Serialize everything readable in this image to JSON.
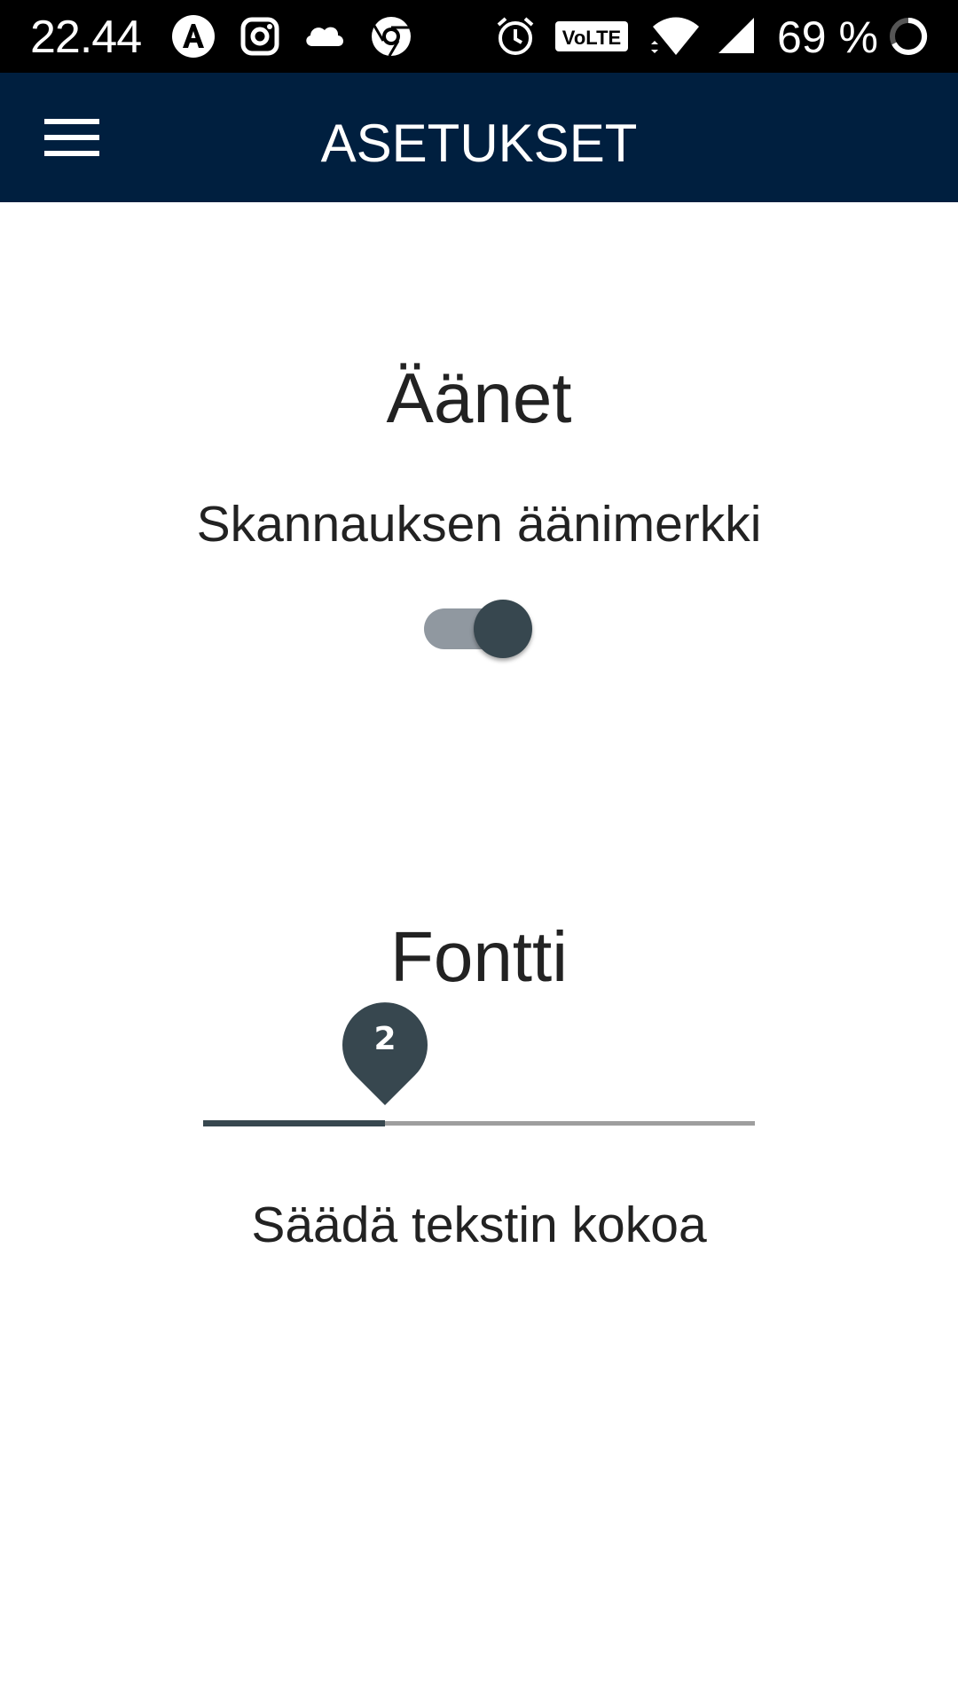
{
  "status_bar": {
    "time": "22.44",
    "battery_percent": "69 %",
    "icons": [
      "a-app-icon",
      "instagram-icon",
      "cloud-icon",
      "chrome-icon",
      "alarm-icon",
      "volte-icon",
      "wifi-icon",
      "signal-icon",
      "battery-ring-icon"
    ],
    "volte_label": "VoLTE"
  },
  "app_bar": {
    "title": "ASETUKSET",
    "background": "#001f3f",
    "menu_icon": "hamburger-menu-icon"
  },
  "sounds_section": {
    "title": "Äänet",
    "setting_label": "Skannauksen äänimerkki",
    "toggle_on": true
  },
  "font_section": {
    "title": "Fontti",
    "slider_value": "2",
    "slider_fraction": 0.33,
    "description": "Säädä tekstin kokoa"
  },
  "colors": {
    "accent": "#37474f",
    "track_inactive": "#9e9e9e",
    "toggle_track": "#9098a0"
  }
}
